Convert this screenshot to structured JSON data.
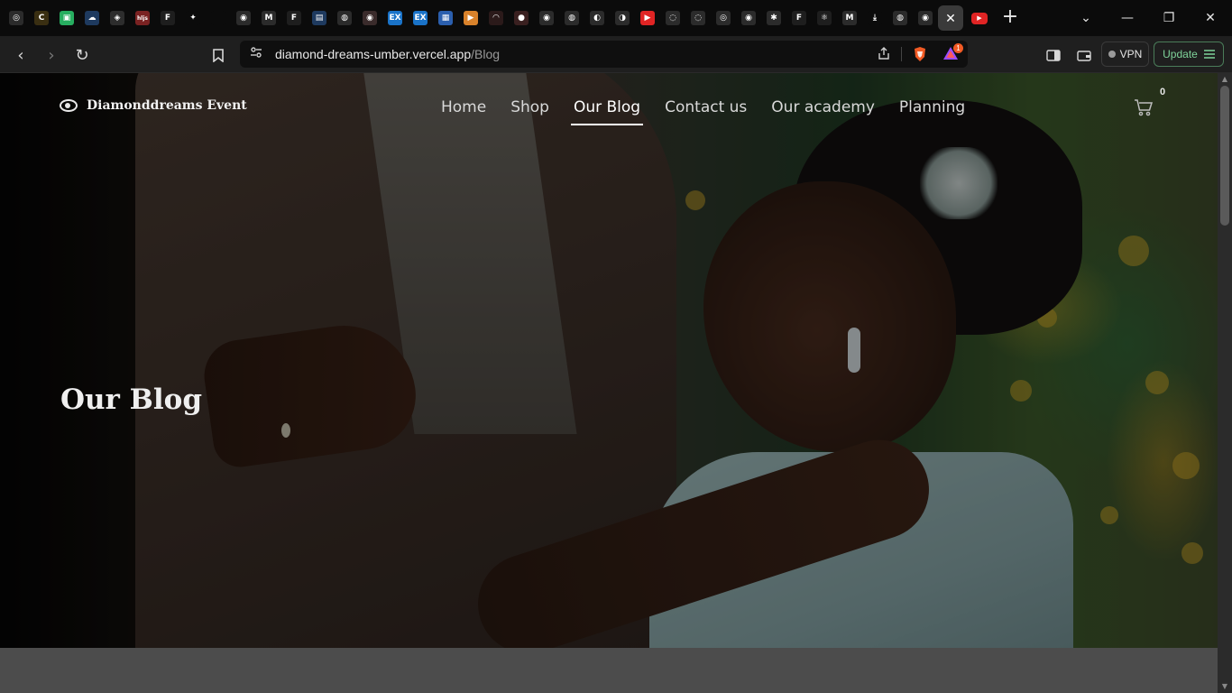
{
  "browser": {
    "tabs": [
      {
        "icon": "chatgpt-icon",
        "color": "#2b2b2b",
        "glyph": "◎"
      },
      {
        "icon": "c-letter-icon",
        "color": "#3a2f12",
        "glyph": "C"
      },
      {
        "icon": "image-tool-icon",
        "color": "#27ae60",
        "glyph": "▣"
      },
      {
        "icon": "cloud-icon",
        "color": "#1e3a5f",
        "glyph": "☁"
      },
      {
        "icon": "codesandbox-icon",
        "color": "#2d2d2d",
        "glyph": "◈"
      },
      {
        "icon": "hljs-icon",
        "color": "#7a2222",
        "glyph": "hljs"
      },
      {
        "icon": "figma-icon",
        "color": "#1e1e1e",
        "glyph": "F"
      },
      {
        "icon": "gemini-icon",
        "color": "#0b0b0b",
        "glyph": "✦"
      },
      {
        "icon": "blank-icon",
        "color": "#0b0b0b",
        "glyph": ""
      },
      {
        "icon": "github-icon",
        "color": "#2b2b2b",
        "glyph": "◉"
      },
      {
        "icon": "gmail-icon",
        "color": "#2b2b2b",
        "glyph": "M"
      },
      {
        "icon": "figma-icon",
        "color": "#1e1e1e",
        "glyph": "F"
      },
      {
        "icon": "chart-icon",
        "color": "#1e3a5f",
        "glyph": "▤"
      },
      {
        "icon": "globe-icon",
        "color": "#2b2b2b",
        "glyph": "◍"
      },
      {
        "icon": "chrome-icon",
        "color": "#3a2b2b",
        "glyph": "◉"
      },
      {
        "icon": "ex-icon",
        "color": "#1a73c8",
        "glyph": "EX"
      },
      {
        "icon": "ex-icon",
        "color": "#1a73c8",
        "glyph": "EX"
      },
      {
        "icon": "image-icon",
        "color": "#2b5fae",
        "glyph": "▦"
      },
      {
        "icon": "play-icon",
        "color": "#d9822b",
        "glyph": "▶"
      },
      {
        "icon": "gauge-icon",
        "color": "#2b1a1a",
        "glyph": "◠"
      },
      {
        "icon": "record-icon",
        "color": "#3a2020",
        "glyph": "●"
      },
      {
        "icon": "github-icon",
        "color": "#2b2b2b",
        "glyph": "◉"
      },
      {
        "icon": "globe-icon",
        "color": "#2b2b2b",
        "glyph": "◍"
      },
      {
        "icon": "tool-icon",
        "color": "#2b2b2b",
        "glyph": "◐"
      },
      {
        "icon": "figma-icon",
        "color": "#2b2b2b",
        "glyph": "◑"
      },
      {
        "icon": "youtube-icon",
        "color": "#e02424",
        "glyph": "▶"
      },
      {
        "icon": "refresh-circle-icon",
        "color": "#2b2b2b",
        "glyph": "◌"
      },
      {
        "icon": "refresh-circle-icon",
        "color": "#2b2b2b",
        "glyph": "◌"
      },
      {
        "icon": "circle-icon",
        "color": "#2b2b2b",
        "glyph": "◎"
      },
      {
        "icon": "github-icon",
        "color": "#2b2b2b",
        "glyph": "◉"
      },
      {
        "icon": "color-icon",
        "color": "#2b2b2b",
        "glyph": "✱"
      },
      {
        "icon": "figma-icon",
        "color": "#1e1e1e",
        "glyph": "F"
      },
      {
        "icon": "react-icon",
        "color": "#1e1e1e",
        "glyph": "⚛"
      },
      {
        "icon": "gmail-icon",
        "color": "#2b2b2b",
        "glyph": "M"
      },
      {
        "icon": "download-icon",
        "color": "#0b0b0b",
        "glyph": "⤓"
      },
      {
        "icon": "globe-icon",
        "color": "#2b2b2b",
        "glyph": "◍"
      },
      {
        "icon": "github-icon",
        "color": "#2b2b2b",
        "glyph": "◉"
      }
    ],
    "active_tab_close": "✕",
    "trailing_tab_icon": "youtube-icon",
    "new_tab": "+",
    "tab_list": "⌄",
    "minimize": "—",
    "restore": "❐",
    "close": "✕",
    "url_host": "diamond-dreams-umber.vercel.app",
    "url_path": "/Blog",
    "brave_badge": "1",
    "vpn_label": "VPN",
    "update_label": "Update"
  },
  "site": {
    "brand": "Diamonddreams Event",
    "nav": [
      "Home",
      "Shop",
      "Our Blog",
      "Contact us",
      "Our academy",
      "Planning"
    ],
    "active_nav": "Our Blog",
    "cart_count": "0",
    "hero_title": "Our Blog"
  },
  "colors": {
    "accent_update": "#7fd39a",
    "brave_orange": "#f15a24"
  }
}
